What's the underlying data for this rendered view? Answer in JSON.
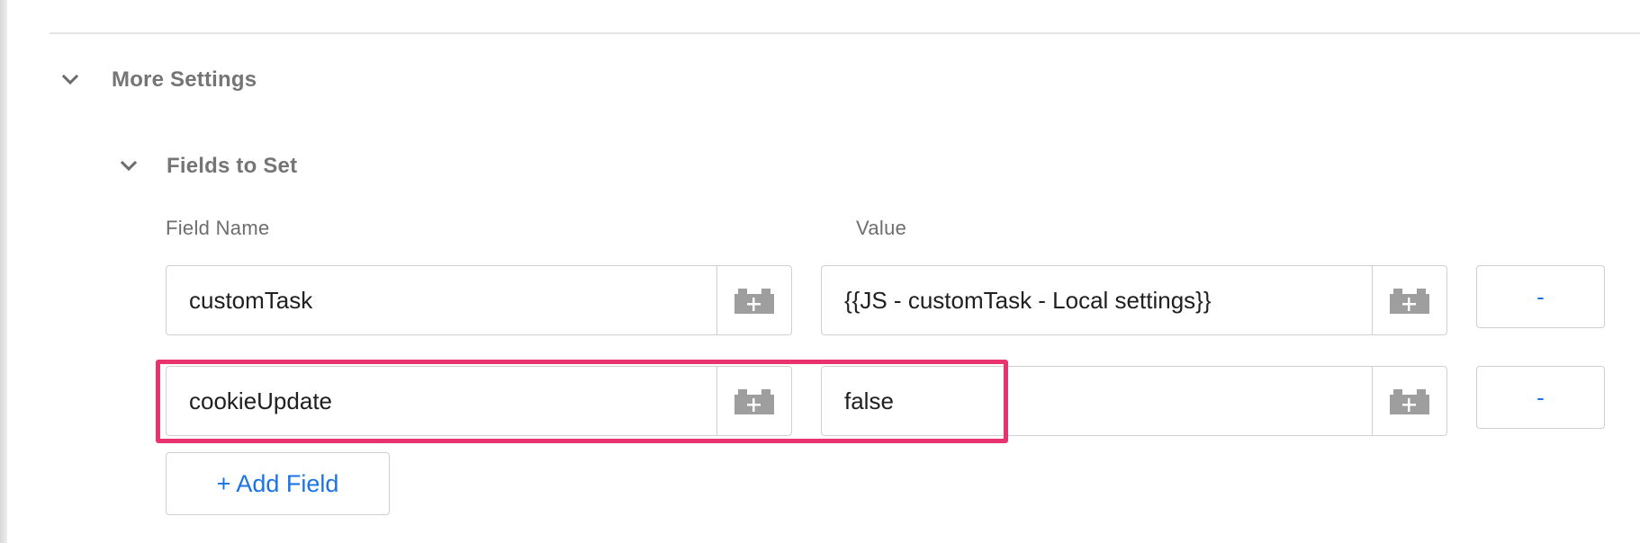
{
  "more_settings": {
    "title": "More Settings",
    "icon": "chevron-down-icon",
    "expanded": true
  },
  "fields_to_set": {
    "title": "Fields to Set",
    "icon": "chevron-down-icon",
    "expanded": true,
    "column_headers": {
      "field_name": "Field Name",
      "value": "Value"
    },
    "rows": [
      {
        "field_name": "customTask",
        "value": "{{JS - customTask - Local settings}}",
        "remove_label": "-"
      },
      {
        "field_name": "cookieUpdate",
        "value": "false",
        "remove_label": "-"
      }
    ],
    "variable_icon": "variable-picker-icon",
    "add_label": "+ Add Field"
  },
  "colors": {
    "accent": "#1a73e8",
    "highlight": "#e8336f",
    "label": "#757575",
    "border": "#cfcfcf"
  }
}
